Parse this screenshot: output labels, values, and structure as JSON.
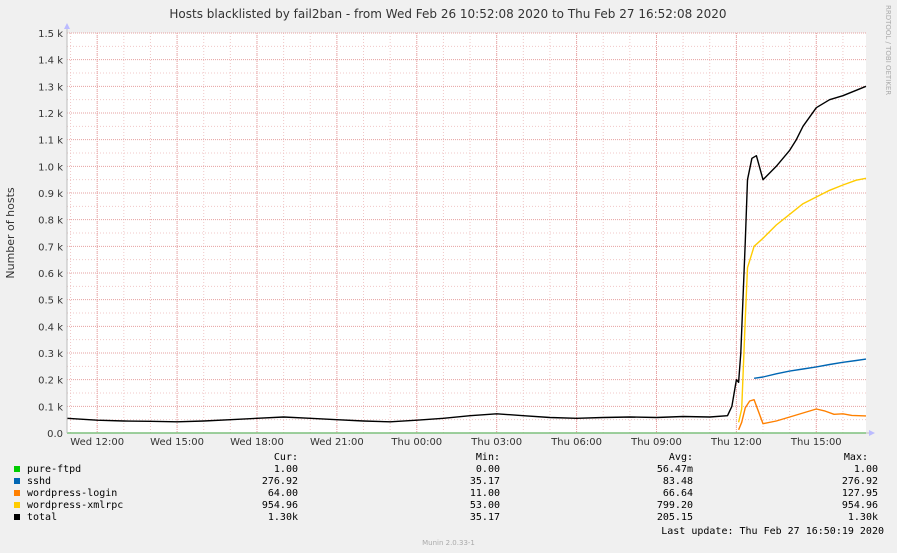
{
  "chart_data": {
    "type": "line",
    "title": "Hosts blacklisted by fail2ban - from Wed Feb 26 10:52:08 2020 to Thu Feb 27 16:52:08 2020",
    "ylabel": "Number of hosts",
    "watermark": "RRDTOOL / TOBI OETIKER",
    "ylim": [
      0,
      1500
    ],
    "xlim": [
      "2020-02-26 10:52",
      "2020-02-27 16:52"
    ],
    "y_ticks": [
      {
        "value": 0,
        "label": "0.0"
      },
      {
        "value": 100,
        "label": "0.1 k"
      },
      {
        "value": 200,
        "label": "0.2 k"
      },
      {
        "value": 300,
        "label": "0.3 k"
      },
      {
        "value": 400,
        "label": "0.4 k"
      },
      {
        "value": 500,
        "label": "0.5 k"
      },
      {
        "value": 600,
        "label": "0.6 k"
      },
      {
        "value": 700,
        "label": "0.7 k"
      },
      {
        "value": 800,
        "label": "0.8 k"
      },
      {
        "value": 900,
        "label": "0.9 k"
      },
      {
        "value": 1000,
        "label": "1.0 k"
      },
      {
        "value": 1100,
        "label": "1.1 k"
      },
      {
        "value": 1200,
        "label": "1.2 k"
      },
      {
        "value": 1300,
        "label": "1.3 k"
      },
      {
        "value": 1400,
        "label": "1.4 k"
      },
      {
        "value": 1500,
        "label": "1.5 k"
      }
    ],
    "x_ticks": [
      {
        "x": "2020-02-26 12:00",
        "label": "Wed 12:00"
      },
      {
        "x": "2020-02-26 15:00",
        "label": "Wed 15:00"
      },
      {
        "x": "2020-02-26 18:00",
        "label": "Wed 18:00"
      },
      {
        "x": "2020-02-26 21:00",
        "label": "Wed 21:00"
      },
      {
        "x": "2020-02-27 00:00",
        "label": "Thu 00:00"
      },
      {
        "x": "2020-02-27 03:00",
        "label": "Thu 03:00"
      },
      {
        "x": "2020-02-27 06:00",
        "label": "Thu 06:00"
      },
      {
        "x": "2020-02-27 09:00",
        "label": "Thu 09:00"
      },
      {
        "x": "2020-02-27 12:00",
        "label": "Thu 12:00"
      },
      {
        "x": "2020-02-27 15:00",
        "label": "Thu 15:00"
      }
    ],
    "grid": true,
    "series": [
      {
        "name": "pure-ftpd",
        "color": "#00cc00",
        "points": [
          [
            "2020-02-26 10:52",
            0
          ],
          [
            "2020-02-27 16:52",
            0
          ]
        ]
      },
      {
        "name": "sshd",
        "color": "#0066b3",
        "points": [
          [
            "2020-02-27 12:40",
            205
          ],
          [
            "2020-02-27 13:00",
            210
          ],
          [
            "2020-02-27 13:30",
            222
          ],
          [
            "2020-02-27 14:00",
            232
          ],
          [
            "2020-02-27 14:30",
            240
          ],
          [
            "2020-02-27 15:00",
            248
          ],
          [
            "2020-02-27 15:30",
            257
          ],
          [
            "2020-02-27 16:00",
            265
          ],
          [
            "2020-02-27 16:30",
            272
          ],
          [
            "2020-02-27 16:52",
            277
          ]
        ]
      },
      {
        "name": "wordpress-login",
        "color": "#ff8000",
        "points": [
          [
            "2020-02-27 12:05",
            12
          ],
          [
            "2020-02-27 12:12",
            40
          ],
          [
            "2020-02-27 12:20",
            95
          ],
          [
            "2020-02-27 12:30",
            120
          ],
          [
            "2020-02-27 12:40",
            125
          ],
          [
            "2020-02-27 13:00",
            35
          ],
          [
            "2020-02-27 13:30",
            45
          ],
          [
            "2020-02-27 14:00",
            60
          ],
          [
            "2020-02-27 14:30",
            75
          ],
          [
            "2020-02-27 15:00",
            90
          ],
          [
            "2020-02-27 15:20",
            82
          ],
          [
            "2020-02-27 15:40",
            70
          ],
          [
            "2020-02-27 16:00",
            72
          ],
          [
            "2020-02-27 16:20",
            66
          ],
          [
            "2020-02-27 16:52",
            64
          ]
        ]
      },
      {
        "name": "wordpress-xmlrpc",
        "color": "#ffcc00",
        "points": [
          [
            "2020-02-27 12:05",
            40
          ],
          [
            "2020-02-27 12:12",
            90
          ],
          [
            "2020-02-27 12:20",
            430
          ],
          [
            "2020-02-27 12:25",
            620
          ],
          [
            "2020-02-27 12:40",
            700
          ],
          [
            "2020-02-27 13:00",
            730
          ],
          [
            "2020-02-27 13:30",
            780
          ],
          [
            "2020-02-27 14:00",
            820
          ],
          [
            "2020-02-27 14:30",
            860
          ],
          [
            "2020-02-27 15:00",
            885
          ],
          [
            "2020-02-27 15:30",
            910
          ],
          [
            "2020-02-27 16:00",
            930
          ],
          [
            "2020-02-27 16:30",
            948
          ],
          [
            "2020-02-27 16:52",
            955
          ]
        ]
      },
      {
        "name": "total",
        "color": "#000000",
        "points": [
          [
            "2020-02-26 10:52",
            55
          ],
          [
            "2020-02-26 12:00",
            48
          ],
          [
            "2020-02-26 13:00",
            45
          ],
          [
            "2020-02-26 14:00",
            44
          ],
          [
            "2020-02-26 15:00",
            42
          ],
          [
            "2020-02-26 16:00",
            45
          ],
          [
            "2020-02-26 17:00",
            50
          ],
          [
            "2020-02-26 18:00",
            55
          ],
          [
            "2020-02-26 19:00",
            60
          ],
          [
            "2020-02-26 20:00",
            55
          ],
          [
            "2020-02-26 21:00",
            50
          ],
          [
            "2020-02-26 22:00",
            45
          ],
          [
            "2020-02-26 23:00",
            42
          ],
          [
            "2020-02-27 00:00",
            48
          ],
          [
            "2020-02-27 01:00",
            55
          ],
          [
            "2020-02-27 02:00",
            65
          ],
          [
            "2020-02-27 03:00",
            72
          ],
          [
            "2020-02-27 04:00",
            65
          ],
          [
            "2020-02-27 05:00",
            58
          ],
          [
            "2020-02-27 06:00",
            55
          ],
          [
            "2020-02-27 07:00",
            58
          ],
          [
            "2020-02-27 08:00",
            60
          ],
          [
            "2020-02-27 09:00",
            58
          ],
          [
            "2020-02-27 10:00",
            62
          ],
          [
            "2020-02-27 11:00",
            60
          ],
          [
            "2020-02-27 11:40",
            65
          ],
          [
            "2020-02-27 11:50",
            100
          ],
          [
            "2020-02-27 12:00",
            200
          ],
          [
            "2020-02-27 12:05",
            190
          ],
          [
            "2020-02-27 12:10",
            300
          ],
          [
            "2020-02-27 12:20",
            720
          ],
          [
            "2020-02-27 12:25",
            950
          ],
          [
            "2020-02-27 12:35",
            1030
          ],
          [
            "2020-02-27 12:45",
            1040
          ],
          [
            "2020-02-27 13:00",
            950
          ],
          [
            "2020-02-27 13:30",
            1000
          ],
          [
            "2020-02-27 14:00",
            1060
          ],
          [
            "2020-02-27 14:15",
            1100
          ],
          [
            "2020-02-27 14:30",
            1150
          ],
          [
            "2020-02-27 15:00",
            1220
          ],
          [
            "2020-02-27 15:30",
            1250
          ],
          [
            "2020-02-27 16:00",
            1265
          ],
          [
            "2020-02-27 16:30",
            1285
          ],
          [
            "2020-02-27 16:52",
            1300
          ]
        ]
      }
    ]
  },
  "legend": {
    "headers": {
      "cur": "Cur:",
      "min": "Min:",
      "avg": "Avg:",
      "max": "Max:"
    },
    "rows": [
      {
        "name": "pure-ftpd",
        "color": "#00cc00",
        "cur": "1.00",
        "min": "0.00",
        "avg": "56.47m",
        "max": "1.00"
      },
      {
        "name": "sshd",
        "color": "#0066b3",
        "cur": "276.92",
        "min": "35.17",
        "avg": "83.48",
        "max": "276.92"
      },
      {
        "name": "wordpress-login",
        "color": "#ff8000",
        "cur": "64.00",
        "min": "11.00",
        "avg": "66.64",
        "max": "127.95"
      },
      {
        "name": "wordpress-xmlrpc",
        "color": "#ffcc00",
        "cur": "954.96",
        "min": "53.00",
        "avg": "799.20",
        "max": "954.96"
      },
      {
        "name": "total",
        "color": "#000000",
        "cur": "1.30k",
        "min": "35.17",
        "avg": "205.15",
        "max": "1.30k"
      }
    ]
  },
  "last_update": "Last update:  Thu Feb 27 16:50:19 2020",
  "footer": "Munin 2.0.33-1"
}
